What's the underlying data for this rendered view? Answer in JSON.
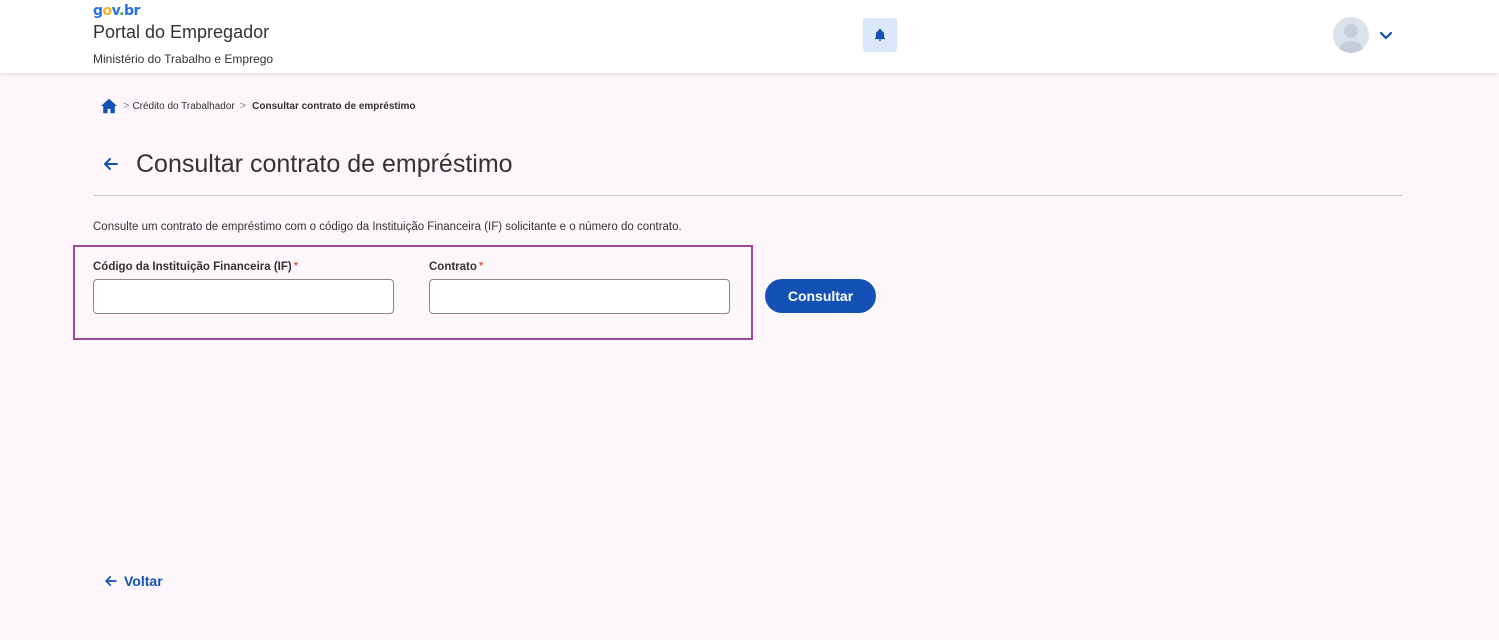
{
  "header": {
    "logo_text": "gov.br",
    "portal_title": "Portal do Empregador",
    "ministry": "Ministério do Trabalho e Emprego"
  },
  "breadcrumb": {
    "items": [
      "Crédito do Trabalhador"
    ],
    "current": "Consultar contrato de empréstimo"
  },
  "page": {
    "title": "Consultar contrato de empréstimo",
    "description": "Consulte um contrato de empréstimo com o código da Instituição Financeira (IF) solicitante e o número do contrato."
  },
  "form": {
    "if_code_label": "Código da Instituição Financeira (IF)",
    "if_code_value": "",
    "contract_label": "Contrato",
    "contract_value": "",
    "required_mark": "*",
    "submit_label": "Consultar"
  },
  "footer": {
    "back_label": "Voltar"
  },
  "colors": {
    "primary": "#1351b4",
    "background": "#fdf7fc",
    "highlight_border": "#9b4a9e",
    "required": "#e52207"
  },
  "icons": {
    "bell": "bell-icon",
    "avatar": "user-avatar-icon",
    "chevron": "chevron-down-icon",
    "home": "home-icon",
    "back": "arrow-left-icon"
  }
}
